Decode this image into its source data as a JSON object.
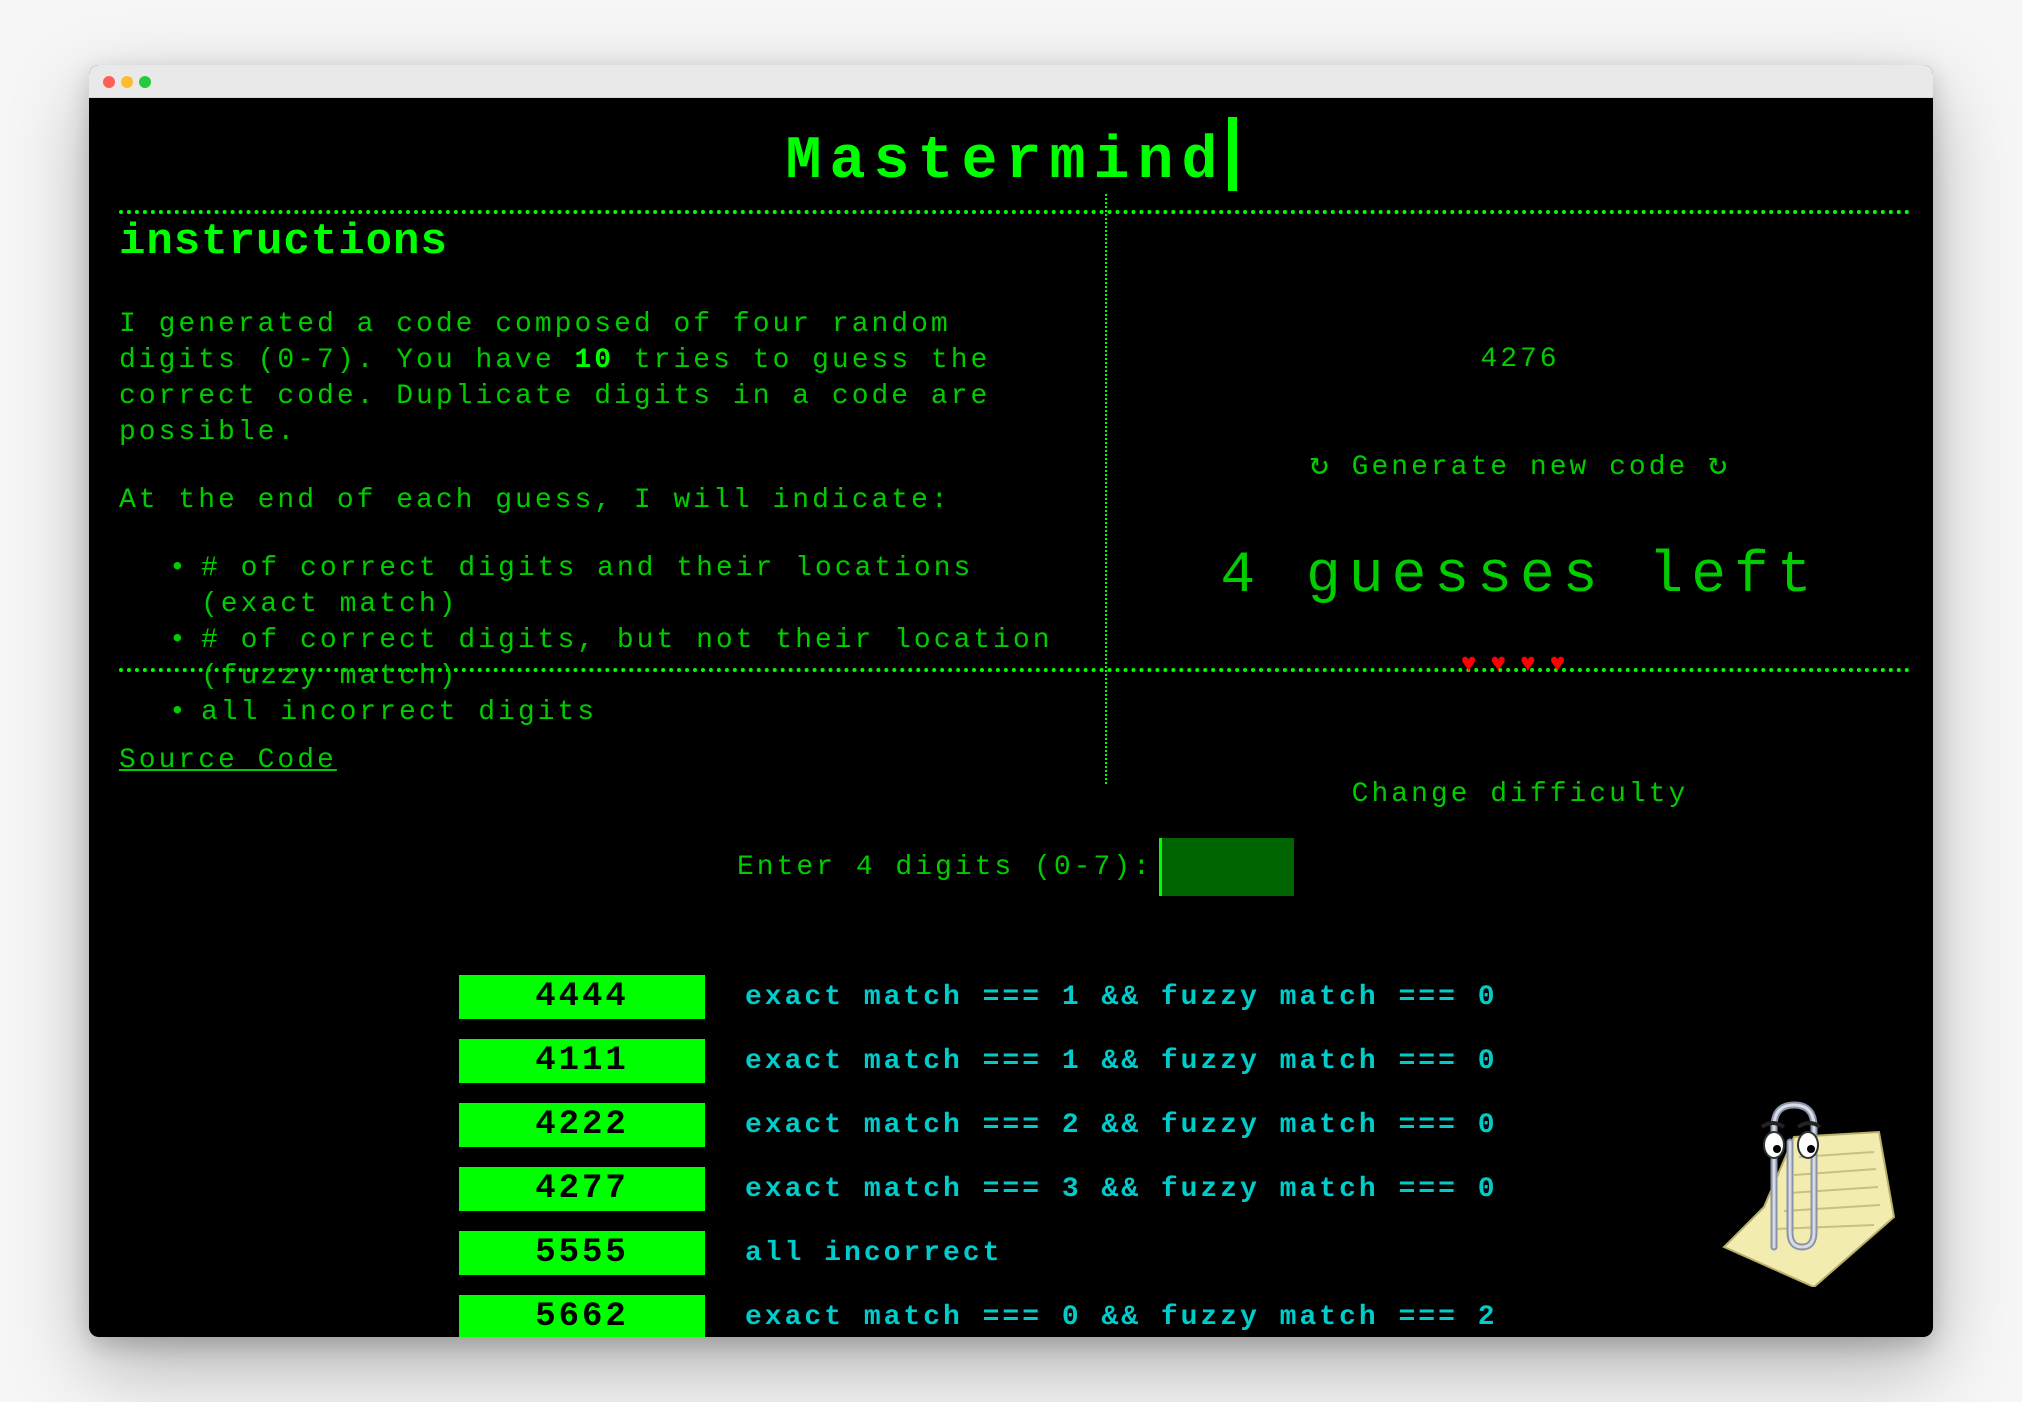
{
  "app": {
    "title": "Mastermind"
  },
  "instructions": {
    "heading": "instructions",
    "intro_part1": "I generated a code composed of four random digits (0-7). You have ",
    "intro_tries": "10",
    "intro_part2": " tries to guess the correct code. Duplicate digits in a code are possible.",
    "indicate": "At the end of each guess, I will indicate:",
    "items": [
      "# of correct digits and their locations (exact match)",
      "# of correct digits, but not their location (fuzzy match)",
      "all incorrect digits"
    ],
    "source_link": "Source Code"
  },
  "status": {
    "secret_code": "4276",
    "generate_label": "Generate new code",
    "guesses_left": "4 guesses left",
    "hearts": "♥♥♥♥",
    "change_difficulty": "Change difficulty"
  },
  "entry": {
    "label": "Enter 4 digits (0-7):",
    "value": ""
  },
  "guesses": [
    {
      "code": "4444",
      "result": "exact match === 1 && fuzzy match === 0"
    },
    {
      "code": "4111",
      "result": "exact match === 1 && fuzzy match === 0"
    },
    {
      "code": "4222",
      "result": "exact match === 2 && fuzzy match === 0"
    },
    {
      "code": "4277",
      "result": "exact match === 3 && fuzzy match === 0"
    },
    {
      "code": "5555",
      "result": "all incorrect"
    },
    {
      "code": "5662",
      "result": "exact match === 0 && fuzzy match === 2"
    }
  ],
  "colors": {
    "terminal_green": "#00ff00",
    "text_green": "#00cc00",
    "result_cyan": "#00cccc",
    "heart_red": "#ff0000",
    "input_bg": "#006400"
  },
  "icons": [
    "refresh-icon",
    "heart-icon",
    "clippy-assistant-icon"
  ]
}
